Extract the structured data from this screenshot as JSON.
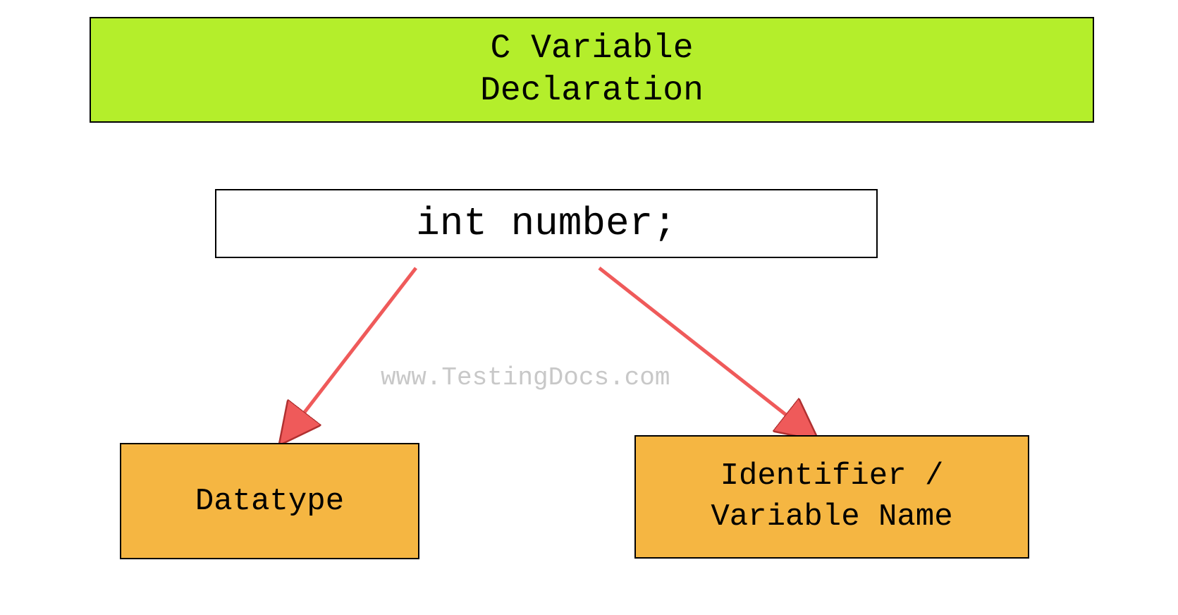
{
  "title": "C Variable\nDeclaration",
  "code": "int number;",
  "watermark": "www.TestingDocs.com",
  "datatype_label": "Datatype",
  "identifier_label": "Identifier /\nVariable Name"
}
